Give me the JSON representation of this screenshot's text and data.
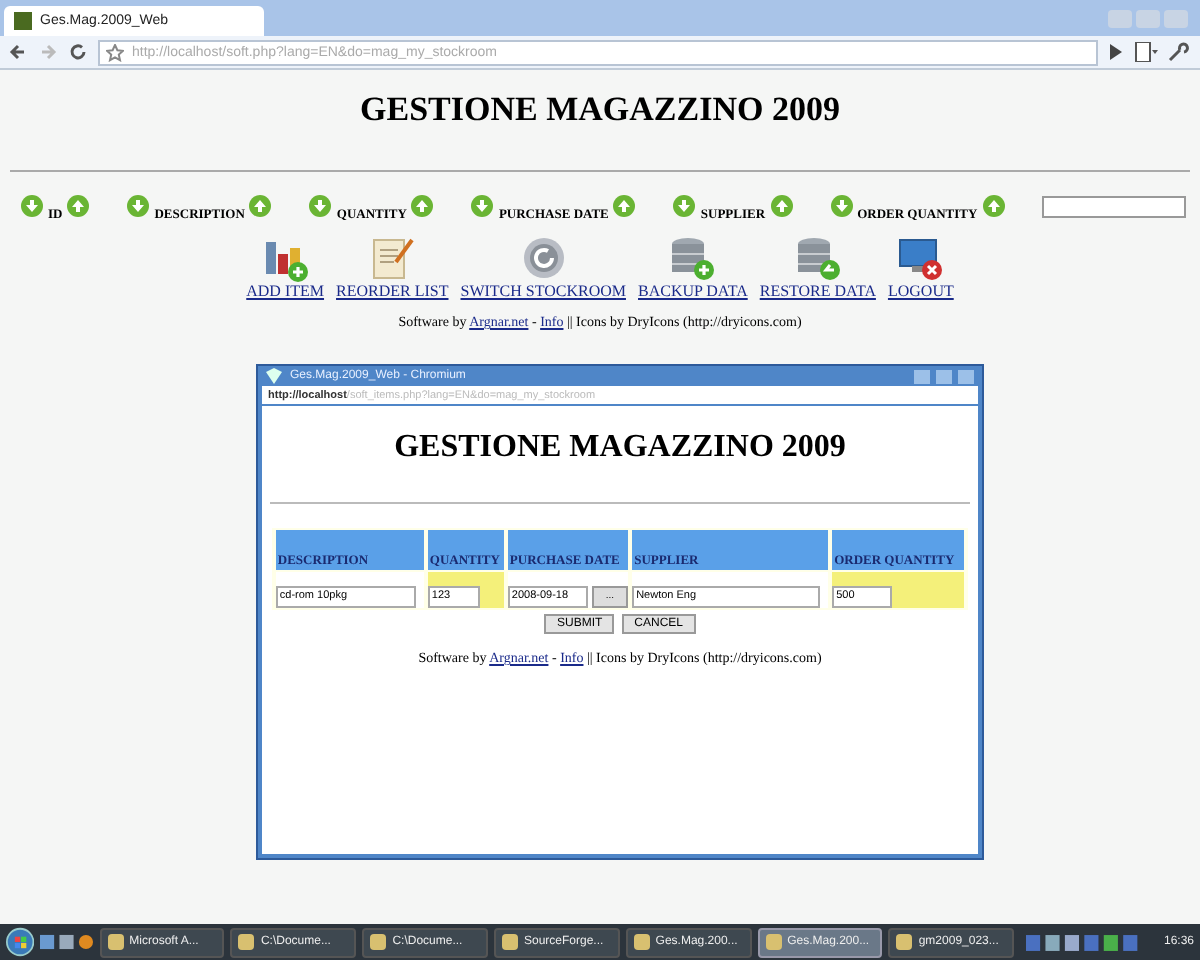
{
  "browser": {
    "tab_title": "Ges.Mag.2009_Web",
    "url": "http://localhost/soft.php?lang=EN&do=mag_my_stockroom"
  },
  "page": {
    "title": "GESTIONE MAGAZZINO 2009",
    "sort_columns": [
      {
        "label": "ID"
      },
      {
        "label": "DESCRIPTION"
      },
      {
        "label": "QUANTITY"
      },
      {
        "label": "PURCHASE DATE"
      },
      {
        "label": "SUPPLIER"
      },
      {
        "label": "ORDER QUANTITY"
      }
    ],
    "actions": [
      {
        "label": "ADD ITEM",
        "kind": "chart"
      },
      {
        "label": "REORDER LIST",
        "kind": "note"
      },
      {
        "label": "SWITCH STOCKROOM",
        "kind": "switch"
      },
      {
        "label": "BACKUP DATA",
        "kind": "backup"
      },
      {
        "label": "RESTORE DATA",
        "kind": "restore"
      },
      {
        "label": "LOGOUT",
        "kind": "logout"
      }
    ],
    "footer": [
      {
        "kind": "text",
        "text": "Software by "
      },
      {
        "kind": "link",
        "text": "Argnar.net"
      },
      {
        "kind": "text",
        "text": " - "
      },
      {
        "kind": "link",
        "text": "Info"
      },
      {
        "kind": "text",
        "text": " || Icons by DryIcons (http://dryicons.com)"
      }
    ]
  },
  "popup": {
    "title": "Ges.Mag.2009_Web - Chromium",
    "url_host": "http://localhost",
    "url_path": "/soft_items.php?lang=EN&do=mag_my_stockroom",
    "page_title": "GESTIONE MAGAZZINO 2009",
    "columns": [
      "DESCRIPTION",
      "QUANTITY",
      "PURCHASE DATE",
      "SUPPLIER",
      "ORDER QUANTITY"
    ],
    "cells": [
      {
        "value": "cd-rom 10pkg",
        "highlighted": false
      },
      {
        "value": "123",
        "highlighted": true
      },
      {
        "value": "2008-09-18",
        "highlighted": false,
        "picker": "..."
      },
      {
        "value": "Newton Eng",
        "highlighted": false
      },
      {
        "value": "500",
        "highlighted": true
      }
    ],
    "buttons": [
      "SUBMIT",
      "CANCEL"
    ],
    "footer": [
      {
        "kind": "text",
        "text": "Software by "
      },
      {
        "kind": "link",
        "text": "Argnar.net"
      },
      {
        "kind": "text",
        "text": " - "
      },
      {
        "kind": "link",
        "text": "Info"
      },
      {
        "kind": "text",
        "text": " || Icons by DryIcons (http://dryicons.com)"
      }
    ]
  },
  "taskbar": {
    "items": [
      {
        "label": "Microsoft A...",
        "selected": false
      },
      {
        "label": "C:\\Docume...",
        "selected": false
      },
      {
        "label": "C:\\Docume...",
        "selected": false
      },
      {
        "label": "SourceForge...",
        "selected": false
      },
      {
        "label": "Ges.Mag.200...",
        "selected": false
      },
      {
        "label": "Ges.Mag.200...",
        "selected": true
      },
      {
        "label": "gm2009_023...",
        "selected": false
      }
    ],
    "clock": "16:36"
  }
}
